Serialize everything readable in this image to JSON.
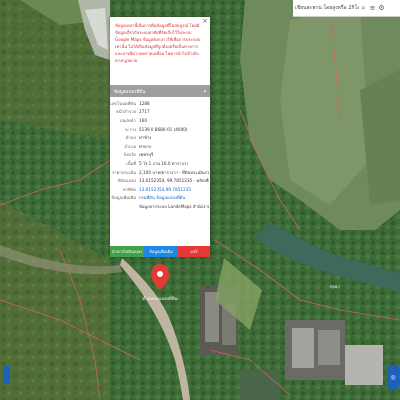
{
  "search": {
    "placeholder": "เขียนสะพาน โดยสูงหรือ 2กิโลกิโ"
  },
  "toolbar": {
    "icons": [
      "search-icon",
      "menu-icon",
      "gear-icon"
    ]
  },
  "popup": {
    "notice": "ข้อมูลเหล่านี้เป็นการคืนข้อมูลที่ไม่สมบูรณ์ โดยมีข้อมูลเกี่ยวกับระบบอาศัยที่จัดเก็บไว้ในระบบ Google Maps ข้อมูลดังกล่าวใช้เพื่อการประกอบเท่านั้น ไม่ได้เป็นข้อมูลที่ถูกต้องหรือเป็นทางการ และอาจมีความคลาดเคลื่อน ไม่ควรนำไปอ้างอิงทางกฎหมาย",
    "section_title": "ข้อมูลแปลงที่ดิน",
    "rows": [
      {
        "label": "เลขโฉนดที่ดิน",
        "value": "1288"
      },
      {
        "label": "หน้าสำรวจ",
        "value": "2717"
      },
      {
        "label": "เล่ม/หน้า",
        "value": "160"
      },
      {
        "label": "ระวาง",
        "value": "5139 II 8680-01 (4000)"
      },
      {
        "label": "ตำบล",
        "value": "ท่าช้าง"
      },
      {
        "label": "อำเภอ",
        "value": "ท่ายาง"
      },
      {
        "label": "จังหวัด",
        "value": "เพชรบุรี"
      },
      {
        "label": "เนื้อที่",
        "value": "5 ไร่ 1 งาน 16.0 ตารางวา"
      },
      {
        "label": "ราคาประเมิน",
        "value": "2,100 บาท/ตารางวา - ที่ดินประเมินรวมทุกแปลง"
      },
      {
        "label": "พิกัดแปลง",
        "value": "13.0152354, 99.7851235 - คลิกเพื่อเปิดแผนที่"
      },
      {
        "label": "ค่าพิกัด",
        "value": "13.0152354,99.7851235"
      },
      {
        "label": "ข้อมูลเพิ่มเติม",
        "value": "กรมที่ดิน ข้อมูลแปลงที่ดิน"
      },
      {
        "label": "",
        "value": "ข้อมูลจากระบบ LandsMaps สำนักงานที่ดิน"
      }
    ],
    "actions": [
      "นำทางไปยังแปลง",
      "ข้อมูลเพิ่มเติม",
      "แชร์"
    ]
  },
  "pin": {
    "label": "ตำแหน่งแปลงที่ดิน"
  },
  "map_labels": [
    "ทุ่งนา"
  ],
  "colors": {
    "notice": "#d32f2f",
    "header": "#9e9e9e",
    "green_btn": "#43a047",
    "blue_btn": "#1e88e5",
    "red_btn": "#e53935",
    "parcel_line": "#d8645e",
    "water": "#3f6a5e"
  }
}
